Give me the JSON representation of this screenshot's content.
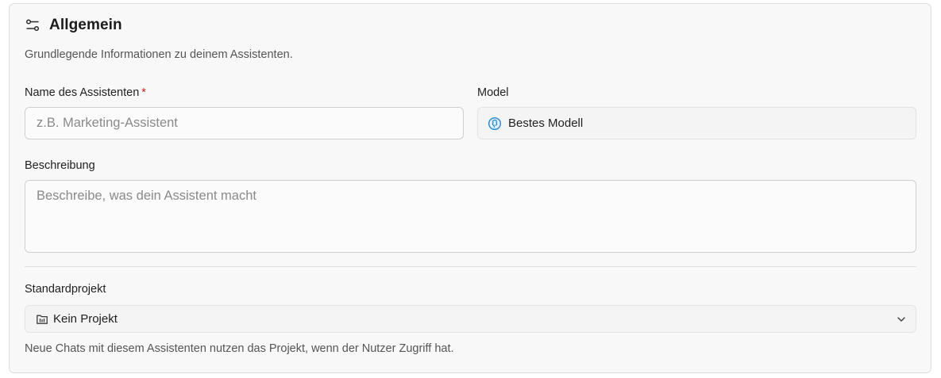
{
  "section": {
    "title": "Allgemein",
    "subtitle": "Grundlegende Informationen zu deinem Assistenten.",
    "icon": "sliders-icon"
  },
  "name_field": {
    "label": "Name des Assistenten",
    "required_marker": "*",
    "placeholder": "z.B. Marketing-Assistent",
    "value": ""
  },
  "model_field": {
    "label": "Model",
    "value": "Bestes Modell",
    "icon": "brain-icon"
  },
  "description_field": {
    "label": "Beschreibung",
    "placeholder": "Beschreibe, was dein Assistent macht",
    "value": ""
  },
  "project_field": {
    "label": "Standardprojekt",
    "value": "Kein Projekt",
    "icon": "folder-icon",
    "hint": "Neue Chats mit diesem Assistenten nutzen das Projekt, wenn der Nutzer Zugriff hat."
  },
  "colors": {
    "required": "#c5221f",
    "model_icon": "#2f8fd6"
  }
}
